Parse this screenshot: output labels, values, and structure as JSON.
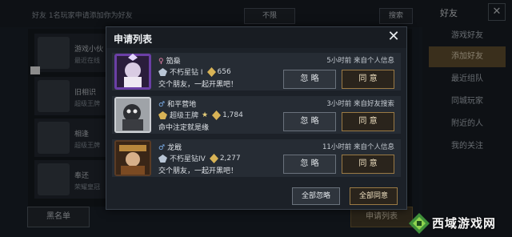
{
  "background": {
    "hint_text": "好友    1名玩家申请添加你为好友",
    "filter_select": "不限",
    "search_button": "搜索",
    "right_panel": {
      "title": "好友",
      "items": [
        "游戏好友",
        "添加好友",
        "最近组队",
        "同城玩家",
        "附近的人",
        "我的关注"
      ]
    },
    "left_rows": [
      {
        "name": "游戏小伙",
        "sub": "最近在线"
      },
      {
        "name": "旧相识",
        "sub": "超级王牌"
      },
      {
        "name": "相逢",
        "sub": "超级王牌"
      },
      {
        "name": "奉还",
        "sub": "荣耀皇冠"
      }
    ],
    "bottom_left_button": "黑名单",
    "bottom_right_button": "申请列表"
  },
  "dialog": {
    "title": "申请列表",
    "close_label": "✕",
    "requests": [
      {
        "gender": "♀",
        "name": "笳燊",
        "time": "5小时前 来自个人信息",
        "tier": "不朽星钻 I",
        "score": "656",
        "message": "交个朋友，一起开黑吧！",
        "ignore_label": "忽 略",
        "agree_label": "同 意"
      },
      {
        "gender": "♂",
        "name": "和平营地",
        "time": "3小时前 来自好友搜索",
        "tier": "超级王牌",
        "score": "1,784",
        "message": "命中注定就是缘",
        "ignore_label": "忽 略",
        "agree_label": "同 意"
      },
      {
        "gender": "♂",
        "name": "龙戢",
        "time": "11小时前 来自个人信息",
        "tier": "不朽星钻IV",
        "score": "2,277",
        "message": "交个朋友，一起开黑吧！",
        "ignore_label": "忽 略",
        "agree_label": "同 意"
      }
    ],
    "ignore_all_label": "全部忽略",
    "agree_all_label": "全部同意"
  },
  "watermark": {
    "text": "西域游戏网"
  },
  "colors": {
    "accent_gold": "#9a7a45",
    "dialog_bg": "#1c2128",
    "row_bg": "#262c34"
  }
}
